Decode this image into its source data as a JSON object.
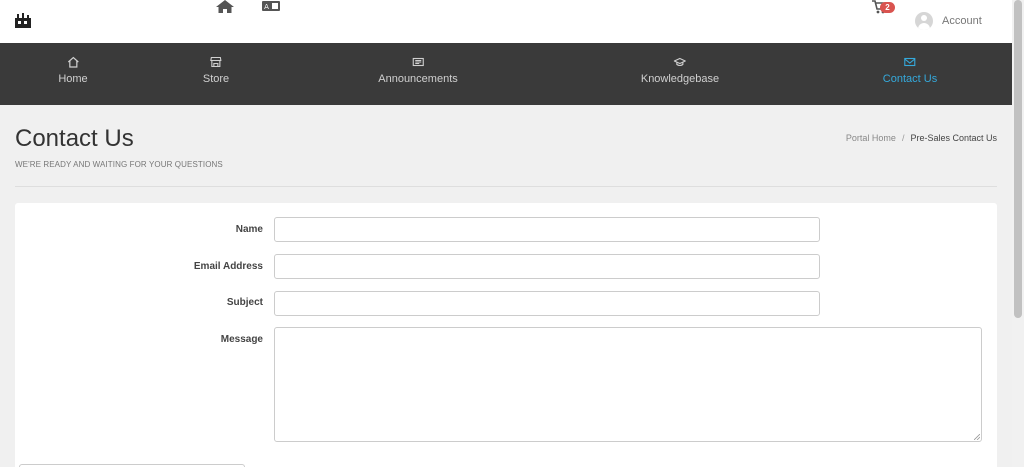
{
  "header": {
    "cart_count": "2",
    "account_label": "Account"
  },
  "nav": [
    {
      "label": "Home",
      "icon": "home-icon"
    },
    {
      "label": "Store",
      "icon": "store-icon"
    },
    {
      "label": "Announcements",
      "icon": "newspaper-icon"
    },
    {
      "label": "Knowledgebase",
      "icon": "graduation-cap-icon"
    },
    {
      "label": "Contact Us",
      "icon": "envelope-icon",
      "active": true
    }
  ],
  "page": {
    "title": "Contact Us",
    "subtitle": "WE'RE READY AND WAITING FOR YOUR QUESTIONS",
    "breadcrumb": [
      {
        "label": "Portal Home"
      },
      {
        "label": "Pre-Sales Contact Us",
        "current": true
      }
    ]
  },
  "form": {
    "name_label": "Name",
    "email_label": "Email Address",
    "subject_label": "Subject",
    "message_label": "Message",
    "name_value": "",
    "email_value": "",
    "subject_value": "",
    "message_value": ""
  },
  "colors": {
    "nav_background": "#3a3a3a",
    "accent": "#35a9db",
    "badge": "#d9534f"
  }
}
